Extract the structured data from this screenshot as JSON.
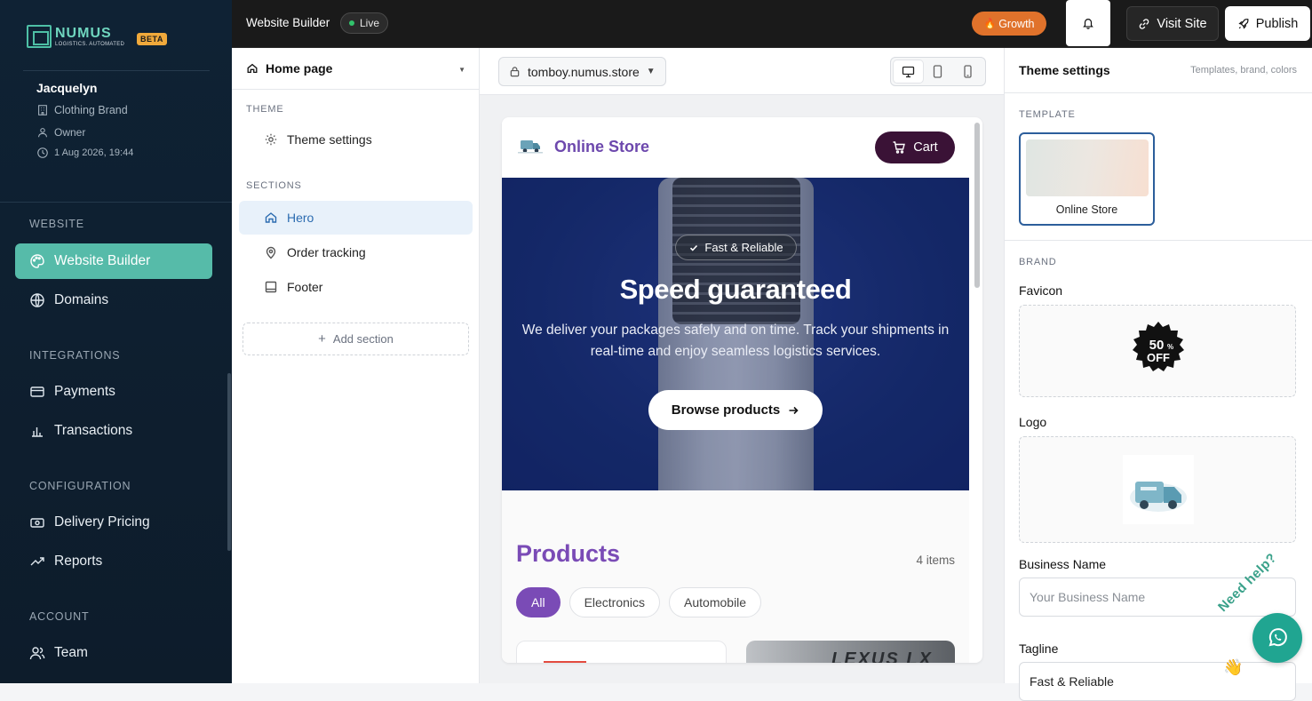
{
  "brand": {
    "name": "NUMUS",
    "tagline": "LOGISTICS. AUTOMATED",
    "beta": "BETA"
  },
  "account": {
    "name": "Jacquelyn",
    "business": "Clothing Brand",
    "role": "Owner",
    "date": "1 Aug 2026, 19:44"
  },
  "sidebar": {
    "sections": [
      {
        "heading": "WEBSITE",
        "items": [
          {
            "label": "Website Builder",
            "icon": "palette-icon",
            "active": true
          },
          {
            "label": "Domains",
            "icon": "globe-icon"
          }
        ]
      },
      {
        "heading": "INTEGRATIONS",
        "items": [
          {
            "label": "Payments",
            "icon": "credit-card-icon"
          },
          {
            "label": "Transactions",
            "icon": "bar-chart-icon"
          }
        ]
      },
      {
        "heading": "CONFIGURATION",
        "items": [
          {
            "label": "Delivery Pricing",
            "icon": "money-icon"
          },
          {
            "label": "Reports",
            "icon": "trend-icon"
          }
        ]
      },
      {
        "heading": "ACCOUNT",
        "items": [
          {
            "label": "Team",
            "icon": "team-icon"
          }
        ]
      }
    ]
  },
  "topbar": {
    "title": "Website Builder",
    "status": "Live",
    "growth": "Growth",
    "visit": "Visit Site",
    "publish": "Publish"
  },
  "builder": {
    "page_select": "Home page",
    "theme_heading": "THEME",
    "theme_item": "Theme settings",
    "sections_heading": "SECTIONS",
    "sections": [
      {
        "label": "Hero",
        "icon": "home-icon"
      },
      {
        "label": "Order tracking",
        "icon": "map-pin-icon"
      },
      {
        "label": "Footer",
        "icon": "footer-icon"
      }
    ],
    "add_section": "Add section"
  },
  "canvas": {
    "url": "tomboy.numus.store",
    "store_name": "Online Store",
    "cart": "Cart",
    "hero_badge": "Fast & Reliable",
    "hero_title": "Speed guaranteed",
    "hero_text": "We deliver your packages safely and on time. Track your shipments in real-time and enjoy seamless logistics services.",
    "hero_cta": "Browse products",
    "products_title": "Products",
    "products_count": "4 items",
    "filters": [
      "All",
      "Electronics",
      "Automobile"
    ],
    "card_text": "LEXUS LX"
  },
  "settings": {
    "title": "Theme settings",
    "subtitle": "Templates, brand, colors",
    "template_heading": "TEMPLATE",
    "template_name": "Online Store",
    "brand_heading": "BRAND",
    "favicon_label": "Favicon",
    "favicon_badge_top": "50",
    "favicon_badge_pct": "%",
    "favicon_badge_bottom": "OFF",
    "logo_label": "Logo",
    "business_name_label": "Business Name",
    "business_name_placeholder": "Your Business Name",
    "tagline_label": "Tagline",
    "tagline_value": "Fast & Reliable"
  },
  "help": {
    "text": "Need help?"
  },
  "colors": {
    "accent": "#56bba9",
    "sidebar": "#0f2234",
    "store_purple": "#7a4bb6",
    "cart": "#3a1236",
    "hero": "#172d72",
    "growth": "#e0722b"
  }
}
